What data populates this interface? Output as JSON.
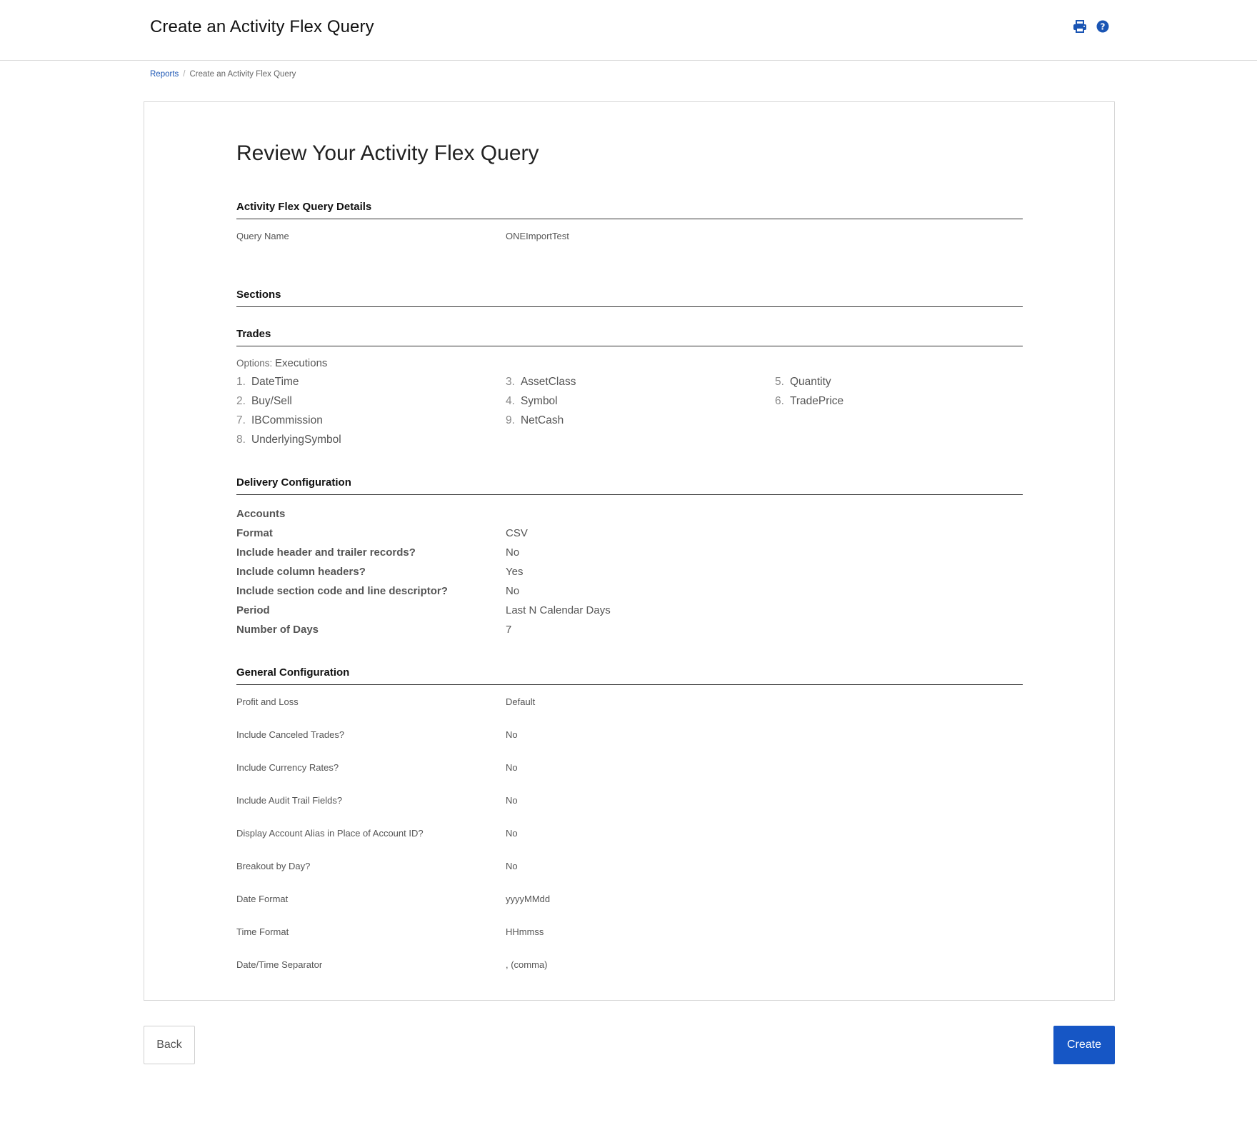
{
  "header": {
    "title": "Create an Activity Flex Query",
    "icons": [
      "print-icon",
      "help-icon"
    ],
    "accent_color": "#1a55b4"
  },
  "breadcrumb": {
    "items": [
      "Reports",
      "Create an Activity Flex Query"
    ],
    "separator": "/"
  },
  "review": {
    "title": "Review Your Activity Flex Query",
    "details": {
      "heading": "Activity Flex Query Details",
      "query_name_label": "Query Name",
      "query_name_value": "ONEImportTest"
    },
    "sections_heading": "Sections",
    "trades": {
      "heading": "Trades",
      "options_label": "Options:",
      "options_value": "Executions",
      "fields": [
        {
          "num": "1.",
          "name": "DateTime"
        },
        {
          "num": "3.",
          "name": "AssetClass"
        },
        {
          "num": "5.",
          "name": "Quantity"
        },
        {
          "num": "2.",
          "name": "Buy/Sell"
        },
        {
          "num": "4.",
          "name": "Symbol"
        },
        {
          "num": "6.",
          "name": "TradePrice"
        },
        {
          "num": "7.",
          "name": "IBCommission"
        },
        {
          "num": "9.",
          "name": "NetCash"
        },
        {
          "num": "8.",
          "name": "UnderlyingSymbol"
        }
      ]
    },
    "delivery": {
      "heading": "Delivery Configuration",
      "rows": [
        {
          "label": "Accounts",
          "value": ""
        },
        {
          "label": "Format",
          "value": "CSV"
        },
        {
          "label": "Include header and trailer records?",
          "value": "No"
        },
        {
          "label": "Include column headers?",
          "value": "Yes"
        },
        {
          "label": "Include section code and line descriptor?",
          "value": "No"
        },
        {
          "label": "Period",
          "value": "Last N Calendar Days"
        },
        {
          "label": "Number of Days",
          "value": "7"
        }
      ]
    },
    "general": {
      "heading": "General Configuration",
      "rows": [
        {
          "label": "Profit and Loss",
          "value": "Default"
        },
        {
          "label": "Include Canceled Trades?",
          "value": "No"
        },
        {
          "label": "Include Currency Rates?",
          "value": "No"
        },
        {
          "label": "Include Audit Trail Fields?",
          "value": "No"
        },
        {
          "label": "Display Account Alias in Place of Account ID?",
          "value": "No"
        },
        {
          "label": "Breakout by Day?",
          "value": "No"
        },
        {
          "label": "Date Format",
          "value": "yyyyMMdd"
        },
        {
          "label": "Time Format",
          "value": "HHmmss"
        },
        {
          "label": "Date/Time Separator",
          "value": ", (comma)"
        }
      ]
    }
  },
  "actions": {
    "back_label": "Back",
    "create_label": "Create",
    "create_color": "#1656c5"
  }
}
